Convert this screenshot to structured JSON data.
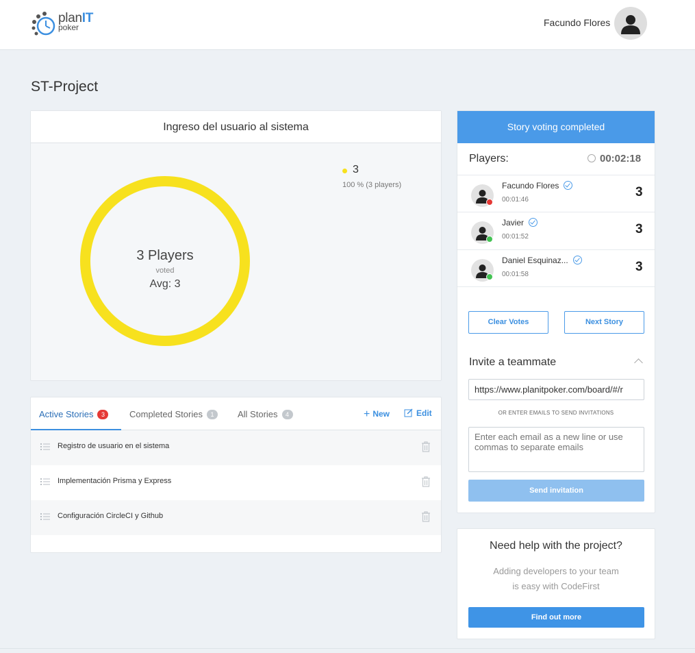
{
  "brand": {
    "name_main": "plan",
    "name_accent": "IT",
    "name_sub": "poker"
  },
  "header": {
    "user_name": "Facundo Flores"
  },
  "page": {
    "title": "ST-Project"
  },
  "result": {
    "story_title": "Ingreso del usuario al sistema",
    "players_text": "3 Players",
    "voted_text": "voted",
    "avg_text": "Avg: 3",
    "legend": {
      "value": "3",
      "detail": "100 % (3 players)"
    },
    "colors": {
      "ring": "#f7e11e"
    }
  },
  "stories": {
    "tabs": [
      {
        "label": "Active Stories",
        "count": "3"
      },
      {
        "label": "Completed Stories",
        "count": "1"
      },
      {
        "label": "All Stories",
        "count": "4"
      }
    ],
    "new_label": "New",
    "edit_label": "Edit",
    "items": [
      {
        "title": "Registro de usuario en el sistema"
      },
      {
        "title": "Implementación Prisma y Express"
      },
      {
        "title": "Configuración CircleCI y Github"
      }
    ]
  },
  "voting": {
    "status": "Story voting completed",
    "players_label": "Players:",
    "timer": "00:02:18",
    "players": [
      {
        "name": "Facundo Flores",
        "time": "00:01:46",
        "vote": "3",
        "status_color": "#e53935"
      },
      {
        "name": "Javier",
        "time": "00:01:52",
        "vote": "3",
        "status_color": "#43c253"
      },
      {
        "name": "Daniel Esquinaz...",
        "time": "00:01:58",
        "vote": "3",
        "status_color": "#43c253"
      }
    ],
    "clear_votes": "Clear Votes",
    "next_story": "Next Story",
    "invite_title": "Invite a teammate",
    "invite_url": "https://www.planitpoker.com/board/#/r",
    "or_emails": "OR ENTER EMAILS TO SEND INVITATIONS",
    "emails_placeholder": "Enter each email as a new line or use commas to separate emails",
    "send_invitation": "Send invitation"
  },
  "help": {
    "title": "Need help with the project?",
    "line1": "Adding developers to your team",
    "line2": "is easy with CodeFirst",
    "button": "Find out more"
  },
  "colors": {
    "accent": "#4a9ae8",
    "badge_red": "#e53935"
  }
}
